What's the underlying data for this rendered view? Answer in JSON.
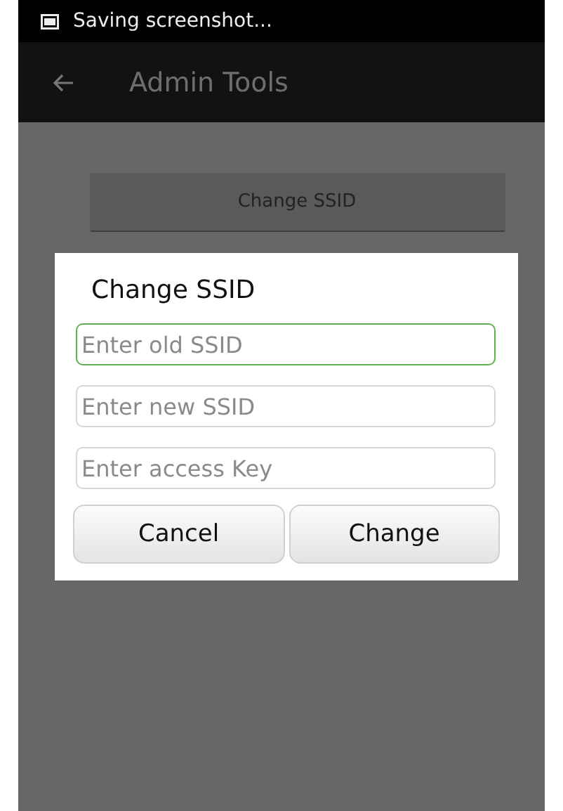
{
  "status_bar": {
    "notification": "Saving screenshot..."
  },
  "app_bar": {
    "title": "Admin Tools"
  },
  "main_button": "Change SSID",
  "dialog": {
    "title": "Change SSID",
    "fields": [
      {
        "placeholder": "Enter old SSID",
        "focused": true
      },
      {
        "placeholder": "Enter new SSID",
        "focused": false
      },
      {
        "placeholder": "Enter access Key",
        "focused": false
      }
    ],
    "buttons": [
      "Cancel",
      "Change"
    ]
  }
}
